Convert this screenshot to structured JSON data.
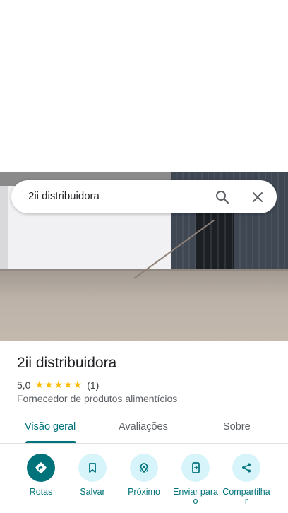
{
  "search": {
    "query": "2ii distribuidora"
  },
  "place": {
    "name": "2ii distribuidora",
    "rating": "5,0",
    "stars": "★★★★★",
    "review_count": "(1)",
    "category": "Fornecedor de produtos alimentícios"
  },
  "tabs": [
    {
      "label": "Visão geral",
      "active": true
    },
    {
      "label": "Avaliações",
      "active": false
    },
    {
      "label": "Sobre",
      "active": false
    }
  ],
  "actions": [
    {
      "label": "Rotas",
      "icon": "directions-icon"
    },
    {
      "label": "Salvar",
      "icon": "bookmark-icon"
    },
    {
      "label": "Próximo",
      "icon": "nearby-icon"
    },
    {
      "label": "Enviar para o",
      "icon": "send-to-phone-icon"
    },
    {
      "label": "Compartilha r",
      "icon": "share-icon"
    }
  ],
  "colors": {
    "accent": "#00737a",
    "accent_light": "#d6f4f9",
    "star": "#fbbc04"
  }
}
